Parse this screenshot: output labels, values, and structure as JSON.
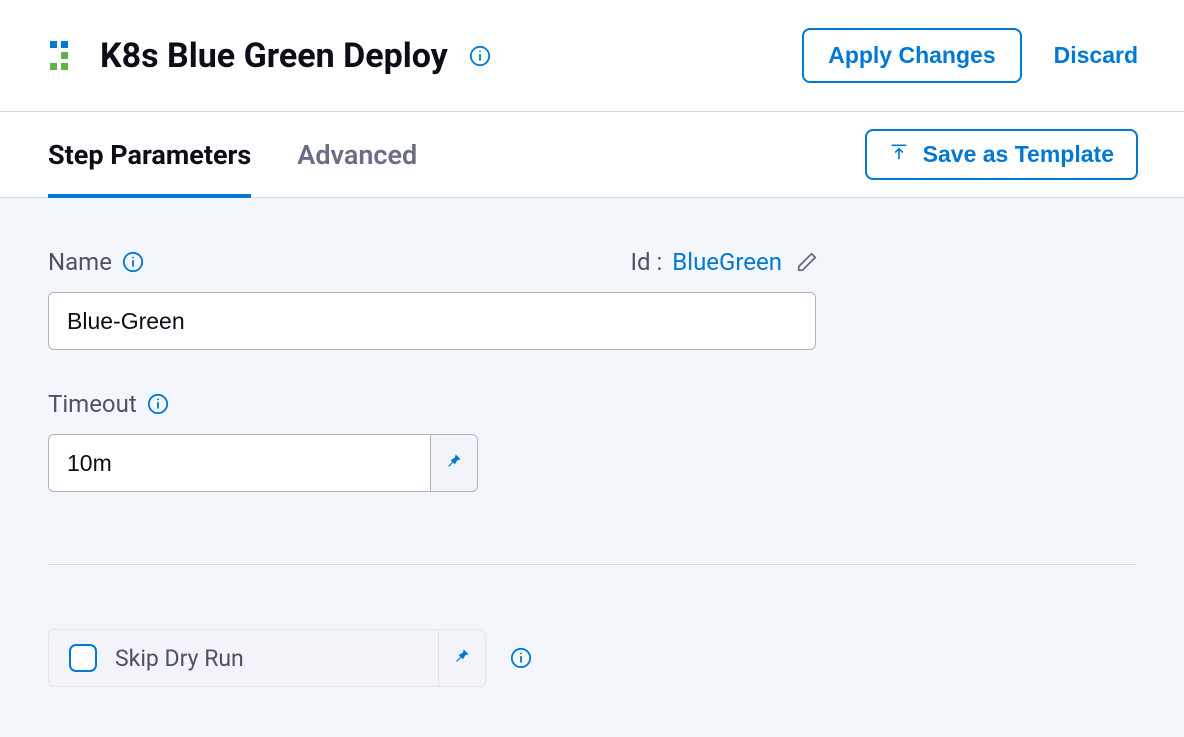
{
  "header": {
    "title": "K8s Blue Green Deploy",
    "apply_label": "Apply Changes",
    "discard_label": "Discard"
  },
  "tabs": {
    "step_parameters": "Step Parameters",
    "advanced": "Advanced",
    "active": "step_parameters"
  },
  "save_template_label": "Save as Template",
  "form": {
    "name_label": "Name",
    "name_value": "Blue-Green",
    "id_label": "Id :",
    "id_value": "BlueGreen",
    "timeout_label": "Timeout",
    "timeout_value": "10m",
    "skip_dry_run_label": "Skip Dry Run",
    "skip_dry_run_checked": false
  },
  "colors": {
    "accent": "#0278d5",
    "text": "#0b0d17",
    "muted": "#4f5162",
    "panel": "#f3f7fc"
  }
}
